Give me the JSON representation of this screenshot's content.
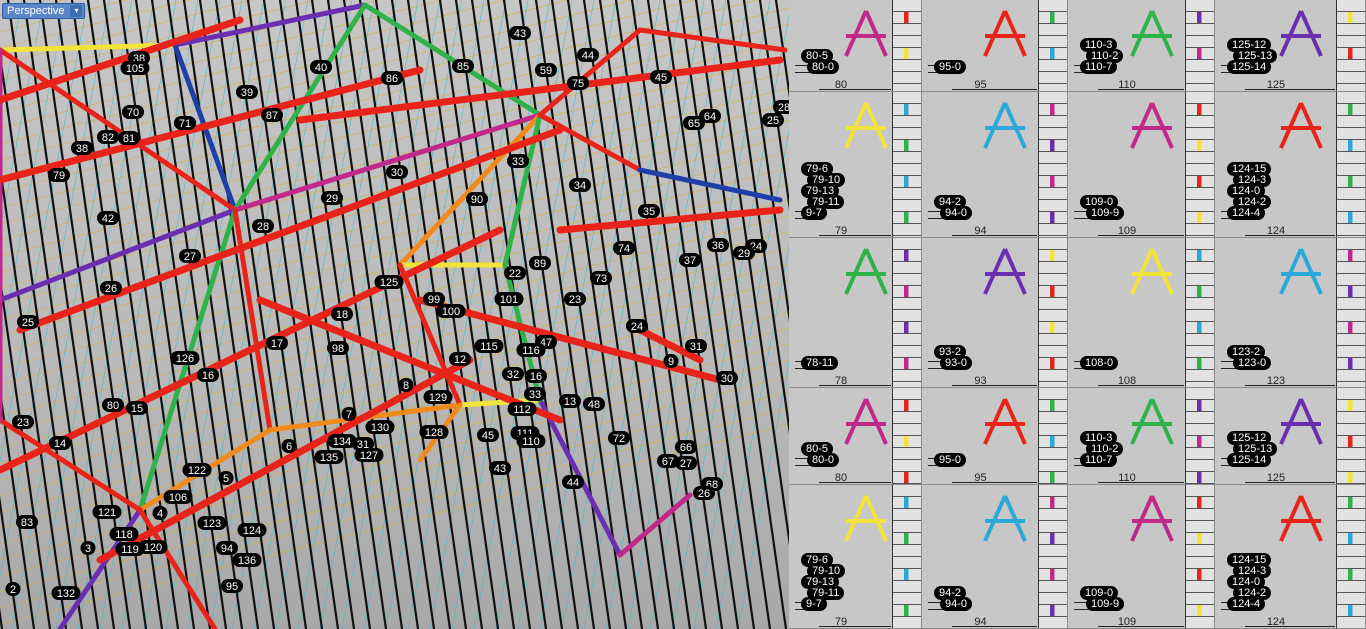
{
  "viewport": {
    "title": "Perspective",
    "labels": [
      "38",
      "105",
      "43",
      "44",
      "40",
      "86",
      "85",
      "59",
      "75",
      "45",
      "28",
      "25",
      "39",
      "87",
      "70",
      "64",
      "65",
      "71",
      "82",
      "81",
      "38",
      "33",
      "30",
      "79",
      "90",
      "34",
      "29",
      "35",
      "42",
      "74",
      "36",
      "24",
      "29",
      "28",
      "27",
      "37",
      "26",
      "89",
      "22",
      "73",
      "125",
      "99",
      "101",
      "18",
      "25",
      "100",
      "23",
      "47",
      "24",
      "126",
      "98",
      "17",
      "115",
      "116",
      "16",
      "31",
      "9",
      "12",
      "32",
      "16",
      "30",
      "80",
      "15",
      "8",
      "33",
      "13",
      "48",
      "14",
      "23",
      "7",
      "129",
      "112",
      "134",
      "130",
      "128",
      "45",
      "111",
      "110",
      "72",
      "66",
      "6",
      "31",
      "67",
      "27",
      "135",
      "127",
      "43",
      "122",
      "5",
      "44",
      "68",
      "26",
      "106",
      "121",
      "4",
      "83",
      "123",
      "124",
      "118",
      "3",
      "119",
      "120",
      "94",
      "136",
      "95",
      "2",
      "132"
    ]
  },
  "sheets": {
    "cells": [
      {
        "number": "80",
        "parts": [
          "80-5",
          "80-0"
        ]
      },
      {
        "number": "95",
        "parts": [
          "95-0"
        ]
      },
      {
        "number": "110",
        "parts": [
          "110-3",
          "110-2",
          "110-7"
        ]
      },
      {
        "number": "125",
        "parts": [
          "125-12",
          "125-13",
          "125-14"
        ]
      },
      {
        "number": "79",
        "parts": [
          "79-6",
          "79-10",
          "79-13",
          "79-11",
          "9-7"
        ]
      },
      {
        "number": "94",
        "parts": [
          "94-2",
          "94-0"
        ]
      },
      {
        "number": "109",
        "parts": [
          "109-0",
          "109-9"
        ]
      },
      {
        "number": "124",
        "parts": [
          "124-15",
          "124-3",
          "124-0",
          "124-2",
          "124-4"
        ]
      },
      {
        "number": "78",
        "parts": [
          "78-11"
        ]
      },
      {
        "number": "93",
        "parts": [
          "93-2",
          "93-0"
        ]
      },
      {
        "number": "108",
        "parts": [
          "108-0"
        ]
      },
      {
        "number": "123",
        "parts": [
          "123-2",
          "123-0"
        ]
      },
      {
        "number": "80",
        "parts": [
          "80-5",
          "80-0"
        ]
      },
      {
        "number": "95",
        "parts": [
          "95-0"
        ]
      },
      {
        "number": "110",
        "parts": [
          "110-3",
          "110-2",
          "110-7"
        ]
      },
      {
        "number": "125",
        "parts": [
          "125-12",
          "125-13",
          "125-14"
        ]
      },
      {
        "number": "79",
        "parts": [
          "79-6",
          "79-10",
          "79-13",
          "79-11",
          "9-7"
        ]
      },
      {
        "number": "94",
        "parts": [
          "94-2",
          "94-0"
        ]
      },
      {
        "number": "109",
        "parts": [
          "109-0",
          "109-9"
        ]
      },
      {
        "number": "124",
        "parts": [
          "124-15",
          "124-3",
          "124-0",
          "124-2",
          "124-4"
        ]
      }
    ]
  },
  "colors": {
    "tab": "#5b87c8",
    "label_bg": "#000000",
    "structure": [
      "#e8241a",
      "#f08a1a",
      "#f2e33a",
      "#2fb24a",
      "#6a2fb0",
      "#c0288a",
      "#1f3fa8",
      "#2aa8d8"
    ]
  }
}
